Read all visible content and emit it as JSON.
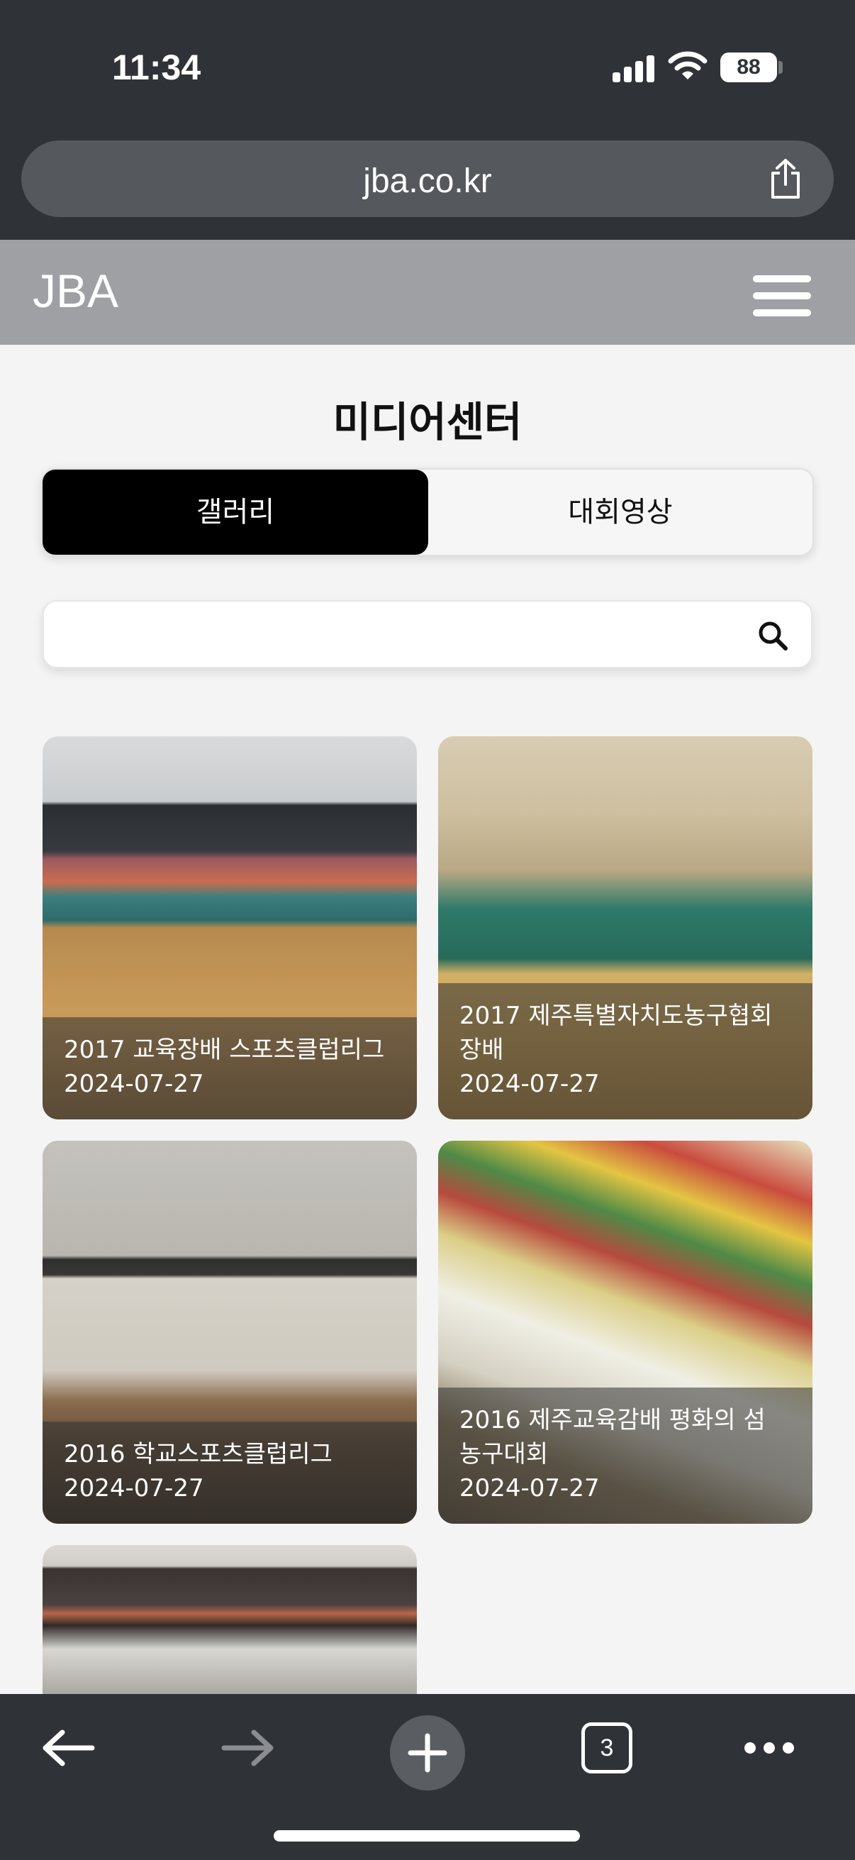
{
  "status_bar": {
    "time": "11:34",
    "battery": "88"
  },
  "browser": {
    "url": "jba.co.kr",
    "open_tabs": "3"
  },
  "site": {
    "logo": "JBA"
  },
  "page": {
    "title": "미디어센터",
    "tabs": [
      {
        "label": "갤러리",
        "active": true
      },
      {
        "label": "대회영상",
        "active": false
      }
    ],
    "search": {
      "value": "",
      "placeholder": ""
    }
  },
  "gallery": [
    {
      "title": "2017 교육장배 스포츠클럽리그",
      "date": "2024-07-27"
    },
    {
      "title": "2017 제주특별자치도농구협회장배",
      "date": "2024-07-27"
    },
    {
      "title": "2016 학교스포츠클럽리그",
      "date": "2024-07-27"
    },
    {
      "title": "2016 제주교육감배 평화의 섬 농구대회",
      "date": "2024-07-27"
    },
    {
      "title": "",
      "date": ""
    }
  ],
  "colors": {
    "browser_chrome": "#2f3236",
    "site_header": "#9ea0a3",
    "active_tab": "#000000"
  }
}
